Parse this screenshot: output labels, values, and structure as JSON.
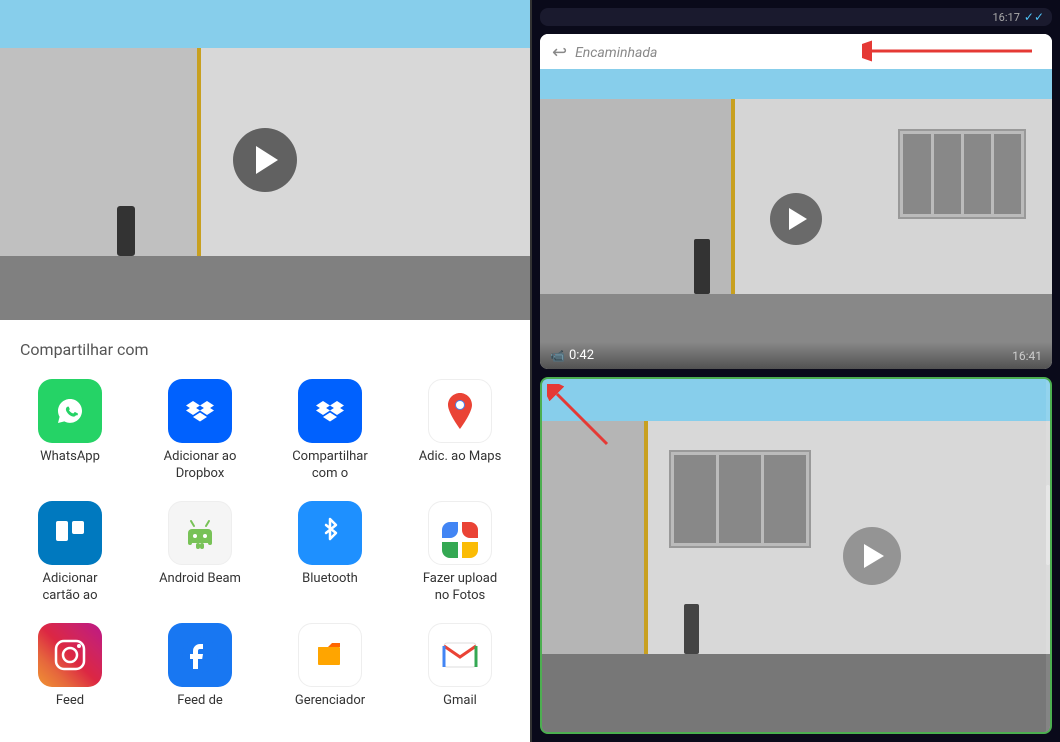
{
  "left_panel": {
    "share_title": "Compartilhar com",
    "apps": [
      {
        "id": "whatsapp",
        "label": "WhatsApp",
        "icon_type": "whatsapp",
        "emoji": "📱"
      },
      {
        "id": "dropbox-add",
        "label": "Adicionar ao\nDropbox",
        "icon_type": "dropbox1",
        "emoji": "📦"
      },
      {
        "id": "dropbox-share",
        "label": "Compartilhar\ncom o",
        "icon_type": "dropbox2",
        "emoji": "📦"
      },
      {
        "id": "maps",
        "label": "Adic. ao Maps",
        "icon_type": "maps",
        "emoji": "🗺️"
      },
      {
        "id": "trello",
        "label": "Adicionar\ncartão ao",
        "icon_type": "trello",
        "emoji": "🗂️"
      },
      {
        "id": "android-beam",
        "label": "Android Beam",
        "icon_type": "android",
        "emoji": "🤖"
      },
      {
        "id": "bluetooth",
        "label": "Bluetooth",
        "icon_type": "bluetooth",
        "emoji": "🔵"
      },
      {
        "id": "photos",
        "label": "Fazer upload\nno Fotos",
        "icon_type": "photos",
        "emoji": "📷"
      },
      {
        "id": "instagram",
        "label": "Feed",
        "icon_type": "instagram",
        "emoji": "📸"
      },
      {
        "id": "facebook",
        "label": "Feed de",
        "icon_type": "facebook",
        "emoji": "📘"
      },
      {
        "id": "files",
        "label": "Gerenciador",
        "icon_type": "files",
        "emoji": "📁"
      },
      {
        "id": "gmail",
        "label": "Gmail",
        "icon_type": "gmail",
        "emoji": "✉️"
      }
    ]
  },
  "right_panel": {
    "top_time": "16:17",
    "forwarded_label": "Encaminhada",
    "video_duration": "0:42",
    "video_time": "16:41",
    "checkmarks": "✓✓"
  }
}
